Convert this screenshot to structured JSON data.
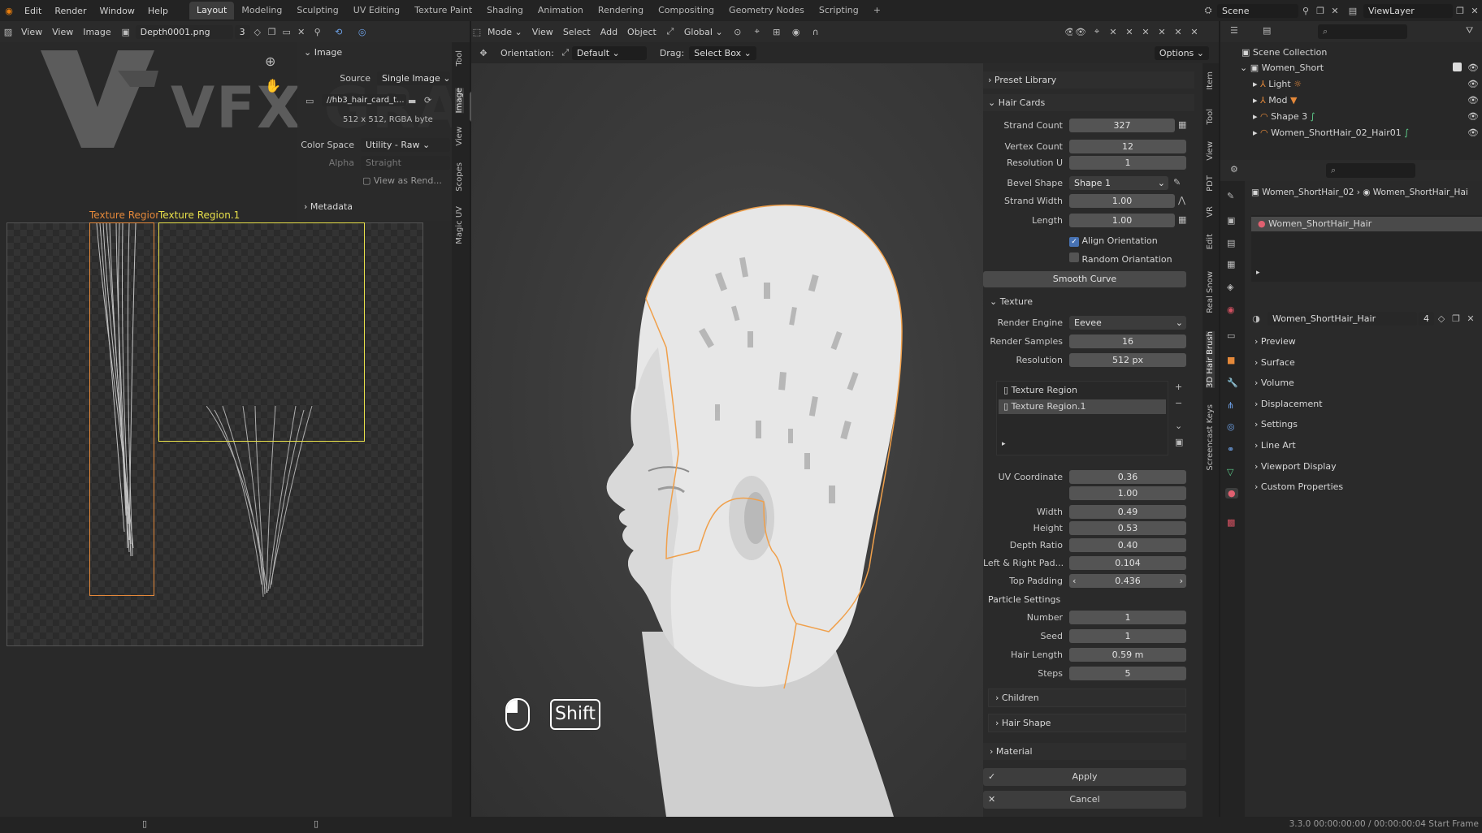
{
  "menu": {
    "items": [
      "Edit",
      "Render",
      "Window",
      "Help"
    ]
  },
  "workspaces": [
    "Layout",
    "Modeling",
    "Sculpting",
    "UV Editing",
    "Texture Paint",
    "Shading",
    "Animation",
    "Rendering",
    "Compositing",
    "Geometry Nodes",
    "Scripting"
  ],
  "scene": {
    "label": "Scene",
    "view_layer": "ViewLayer"
  },
  "image_editor": {
    "view": "View",
    "view2": "View",
    "image": "Image",
    "image_name": "Depth0001.png",
    "users": "3",
    "watermark": "VFX GRACE",
    "panel": {
      "title": "Image",
      "source_label": "Source",
      "source_value": "Single Image",
      "file_path": "//hb3_hair_card_t...",
      "resolution_info": "512 x 512,  RGBA byte",
      "color_space_label": "Color Space",
      "color_space_value": "Utility - Raw",
      "alpha_label": "Alpha",
      "alpha_value": "Straight",
      "view_as_render": "View as Rend...",
      "metadata": "Metadata"
    },
    "region_label_1": "Texture Region",
    "region_label_2": "Texture Region.1",
    "side_tabs": [
      "Tool",
      "Image",
      "View",
      "Scopes",
      "Magic UV"
    ]
  },
  "viewport": {
    "mode": "Mode",
    "view": "View",
    "select": "Select",
    "add": "Add",
    "object": "Object",
    "transform": "Global",
    "orientation_label": "Orientation:",
    "orientation_value": "Default",
    "drag_label": "Drag:",
    "drag_value": "Select Box",
    "options": "Options",
    "key_overlay": "Shift"
  },
  "hair_panel": {
    "preset_library": "Preset Library",
    "hair_cards": "Hair Cards",
    "strand_count_label": "Strand Count",
    "strand_count": "327",
    "vertex_count_label": "Vertex Count",
    "vertex_count": "12",
    "resolution_u_label": "Resolution U",
    "resolution_u": "1",
    "bevel_shape_label": "Bevel Shape",
    "bevel_shape": "Shape 1",
    "strand_width_label": "Strand Width",
    "strand_width": "1.00",
    "length_label": "Length",
    "length": "1.00",
    "align_orientation": "Align Orientation",
    "random_orientation": "Random Oriantation",
    "smooth_curve": "Smooth Curve",
    "texture": "Texture",
    "render_engine_label": "Render Engine",
    "render_engine": "Eevee",
    "render_samples_label": "Render Samples",
    "render_samples": "16",
    "resolution_label": "Resolution",
    "resolution": "512 px",
    "regions": [
      "Texture Region",
      "Texture Region.1"
    ],
    "uv_coordinate_label": "UV Coordinate",
    "uv_x": "0.36",
    "uv_y": "1.00",
    "width_label": "Width",
    "width": "0.49",
    "height_label": "Height",
    "height": "0.53",
    "depth_ratio_label": "Depth Ratio",
    "depth_ratio": "0.40",
    "lr_pad_label": "Left & Right Pad...",
    "lr_pad": "0.104",
    "top_padding_label": "Top Padding",
    "top_padding": "0.436",
    "particle_settings": "Particle Settings",
    "number_label": "Number",
    "number": "1",
    "seed_label": "Seed",
    "seed": "1",
    "hair_length_label": "Hair Length",
    "hair_length": "0.59 m",
    "steps_label": "Steps",
    "steps": "5",
    "children": "Children",
    "hair_shape": "Hair Shape",
    "material": "Material",
    "apply": "Apply",
    "cancel": "Cancel"
  },
  "n_tabs": [
    "Item",
    "Tool",
    "View",
    "PDT",
    "VR",
    "Edit",
    "Real Snow",
    "3D Hair Brush",
    "Screencast Keys"
  ],
  "outliner": {
    "scene_collection": "Scene Collection",
    "items": [
      "Women_Short",
      "Light",
      "Mod",
      "Shape 3",
      "Women_ShortHair_02_Hair01"
    ]
  },
  "properties": {
    "breadcrumb_1": "Women_ShortHair_02",
    "breadcrumb_2": "Women_ShortHair_Hai",
    "slot": "Women_ShortHair_Hair",
    "material_name": "Women_ShortHair_Hair",
    "material_users": "4",
    "sections": [
      "Preview",
      "Surface",
      "Volume",
      "Displacement",
      "Settings",
      "Line Art",
      "Viewport Display",
      "Custom Properties"
    ]
  },
  "status": {
    "version_time": "3.3.0  00:00:00:00 / 00:00:00:04  Start Frame"
  },
  "colors": {
    "accent_blue": "#4772b3",
    "region_orange": "#e5893a",
    "region_yellow": "#e8e04a",
    "selection_orange": "#f0a04b"
  }
}
